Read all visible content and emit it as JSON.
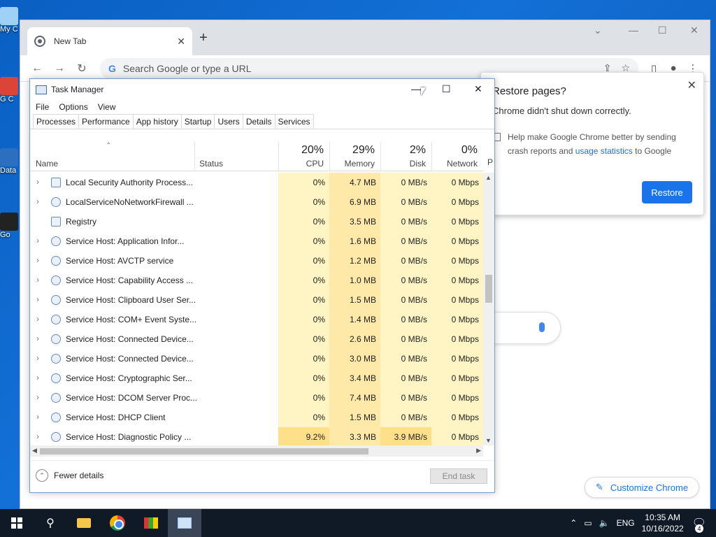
{
  "desktop": {
    "icons": [
      "My C",
      "G C",
      "Data",
      "Go"
    ]
  },
  "chrome": {
    "tab_title": "New Tab",
    "omnibox_placeholder": "Search Google or type a URL",
    "restore_popup": {
      "title": "Restore pages?",
      "message": "Chrome didn't shut down correctly.",
      "checkbox_text_1": "Help make Google Chrome better by sending",
      "checkbox_text_2": "crash reports and",
      "checkbox_link": "usage statistics",
      "checkbox_text_3": "to Google",
      "button": "Restore"
    },
    "customize_label": "Customize Chrome"
  },
  "taskmanager": {
    "title": "Task Manager",
    "menu": [
      "File",
      "Options",
      "View"
    ],
    "tabs": [
      "Processes",
      "Performance",
      "App history",
      "Startup",
      "Users",
      "Details",
      "Services"
    ],
    "columns": {
      "name": "Name",
      "status": "Status",
      "cpu_pct": "20%",
      "cpu": "CPU",
      "mem_pct": "29%",
      "mem": "Memory",
      "disk_pct": "2%",
      "disk": "Disk",
      "net_pct": "0%",
      "net": "Network",
      "p": "P"
    },
    "rows": [
      {
        "name": "Local Security Authority Process...",
        "cpu": "0%",
        "mem": "4.7 MB",
        "disk": "0 MB/s",
        "net": "0 Mbps",
        "expand": true,
        "icon": "app"
      },
      {
        "name": "LocalServiceNoNetworkFirewall ...",
        "cpu": "0%",
        "mem": "6.9 MB",
        "disk": "0 MB/s",
        "net": "0 Mbps",
        "expand": true,
        "icon": "gear"
      },
      {
        "name": "Registry",
        "cpu": "0%",
        "mem": "3.5 MB",
        "disk": "0 MB/s",
        "net": "0 Mbps",
        "expand": false,
        "icon": "app"
      },
      {
        "name": "Service Host: Application Infor...",
        "cpu": "0%",
        "mem": "1.6 MB",
        "disk": "0 MB/s",
        "net": "0 Mbps",
        "expand": true,
        "icon": "gear"
      },
      {
        "name": "Service Host: AVCTP service",
        "cpu": "0%",
        "mem": "1.2 MB",
        "disk": "0 MB/s",
        "net": "0 Mbps",
        "expand": true,
        "icon": "gear"
      },
      {
        "name": "Service Host: Capability Access ...",
        "cpu": "0%",
        "mem": "1.0 MB",
        "disk": "0 MB/s",
        "net": "0 Mbps",
        "expand": true,
        "icon": "gear"
      },
      {
        "name": "Service Host: Clipboard User Ser...",
        "cpu": "0%",
        "mem": "1.5 MB",
        "disk": "0 MB/s",
        "net": "0 Mbps",
        "expand": true,
        "icon": "gear"
      },
      {
        "name": "Service Host: COM+ Event Syste...",
        "cpu": "0%",
        "mem": "1.4 MB",
        "disk": "0 MB/s",
        "net": "0 Mbps",
        "expand": true,
        "icon": "gear"
      },
      {
        "name": "Service Host: Connected Device...",
        "cpu": "0%",
        "mem": "2.6 MB",
        "disk": "0 MB/s",
        "net": "0 Mbps",
        "expand": true,
        "icon": "gear"
      },
      {
        "name": "Service Host: Connected Device...",
        "cpu": "0%",
        "mem": "3.0 MB",
        "disk": "0 MB/s",
        "net": "0 Mbps",
        "expand": true,
        "icon": "gear"
      },
      {
        "name": "Service Host: Cryptographic Ser...",
        "cpu": "0%",
        "mem": "3.4 MB",
        "disk": "0 MB/s",
        "net": "0 Mbps",
        "expand": true,
        "icon": "gear"
      },
      {
        "name": "Service Host: DCOM Server Proc...",
        "cpu": "0%",
        "mem": "7.4 MB",
        "disk": "0 MB/s",
        "net": "0 Mbps",
        "expand": true,
        "icon": "gear"
      },
      {
        "name": "Service Host: DHCP Client",
        "cpu": "0%",
        "mem": "1.5 MB",
        "disk": "0 MB/s",
        "net": "0 Mbps",
        "expand": true,
        "icon": "gear"
      },
      {
        "name": "Service Host: Diagnostic Policy ...",
        "cpu": "9.2%",
        "mem": "3.3 MB",
        "disk": "3.9 MB/s",
        "net": "0 Mbps",
        "expand": true,
        "icon": "gear",
        "hot": true
      }
    ],
    "fewer_details": "Fewer details",
    "end_task": "End task"
  },
  "taskbar": {
    "lang": "ENG",
    "time": "10:35 AM",
    "date": "10/16/2022",
    "notif_count": "4"
  }
}
